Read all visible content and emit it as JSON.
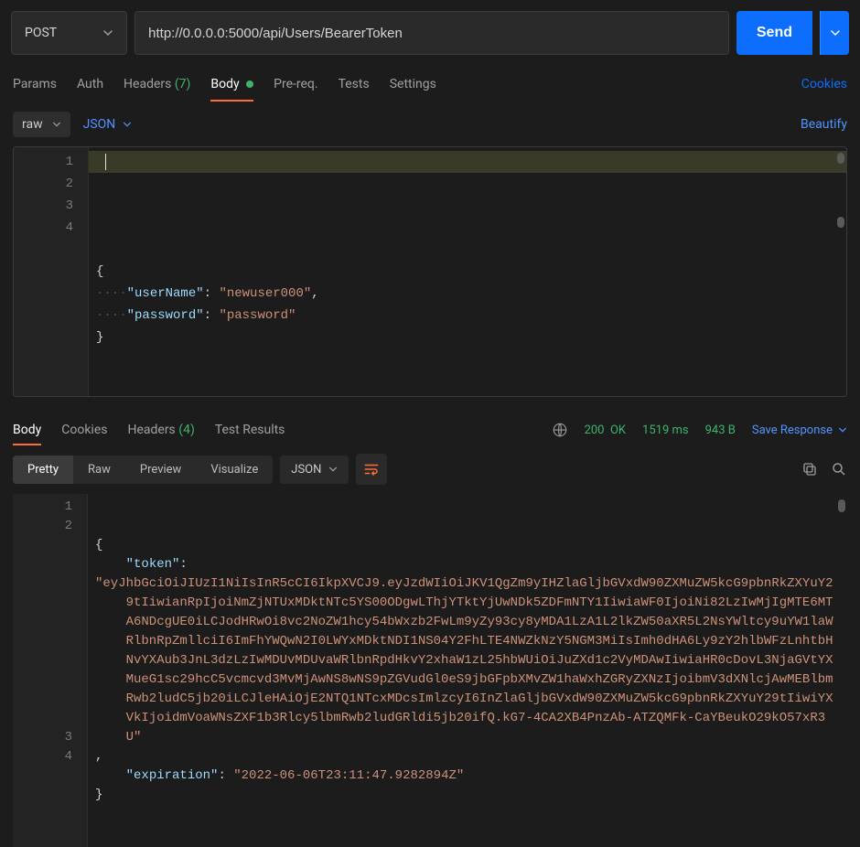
{
  "request": {
    "method": "POST",
    "url": "http://0.0.0.0:5000/api/Users/BearerToken",
    "send_label": "Send"
  },
  "req_tabs": {
    "params": "Params",
    "auth": "Auth",
    "headers_label": "Headers",
    "headers_count": "(7)",
    "body": "Body",
    "prereq": "Pre-req.",
    "tests": "Tests",
    "settings": "Settings",
    "cookies": "Cookies"
  },
  "body_toolbar": {
    "mode": "raw",
    "format": "JSON",
    "beautify": "Beautify"
  },
  "body_editor": {
    "lines": [
      "1",
      "2",
      "3",
      "4"
    ],
    "content": {
      "l1": "{",
      "l2_key": "\"userName\"",
      "l2_val": "\"newuser000\"",
      "l3_key": "\"password\"",
      "l3_val": "\"password\"",
      "l4": "}"
    }
  },
  "resp_tabs": {
    "body": "Body",
    "cookies": "Cookies",
    "headers_label": "Headers",
    "headers_count": "(4)",
    "test_results": "Test Results"
  },
  "status": {
    "code": "200",
    "text": "OK",
    "time": "1519 ms",
    "size": "943 B",
    "save": "Save Response"
  },
  "view_toolbar": {
    "pretty": "Pretty",
    "raw": "Raw",
    "preview": "Preview",
    "visualize": "Visualize",
    "format": "JSON"
  },
  "response_editor": {
    "lines": [
      "1",
      "2",
      "",
      "",
      "",
      "",
      "",
      "",
      "",
      "",
      "",
      "",
      "3",
      "4"
    ],
    "content": {
      "l1": "{",
      "token_key": "\"token\"",
      "token_val": "\"eyJhbGciOiJIUzI1NiIsInR5cCI6IkpXVCJ9.eyJzdWIiOiJKV1QgZm9yIHZlaGljbGVxdW90ZXMuZW5kcG9pbnRkZXYuY29tIiwianRpIjoiNmZjNTUxMDktNTc5YS00ODgwLThjYTktYjUwNDk5ZDFmNTY1IiwiaWF0IjoiNi82LzIwMjIgMTE6MTA6NDcgUE0iLCJodHRwOi8vc2NoZW1hcy54bWxzb2FwLm9yZy93cy8yMDA1LzA1L2lkZW50aXR5L2NsYWltcy9uYW1laWRlbnRpZmllciI6ImFhYWQwN2I0LWYxMDktNDI1NS04Y2FhLTE4NWZkNzY5NGM3MiIsImh0dHA6Ly9zY2hlbWFzLnhtbHNvYXAub3JnL3dzLzIwMDUvMDUvaWRlbnRpdHkvY2xhaW1zL25hbWUiOiJuZXd1c2VyMDAwIiwiaHR0cDovL3NjaGVtYXMueG1sc29hcC5vcmcvd3MvMjAwNS8wNS9pZGVudGl0eS9jbGFpbXMvZW1haWxhZGRyZXNzIjoibmV3dXNlcjAwMEBlbmRwb2ludC5jb20iLCJleHAiOjE2NTQ1NTcxMDcsImlzcyI6InZlaGljbGVxdW90ZXMuZW5kcG9pbnRkZXYuY29tIiwiYXVkIjoidmVoaWNsZXF1b3Rlcy5lbmRwb2ludGRldi5jb20ifQ.kG7-4CA2XB4PnzAb-ATZQMFk-CaYBeukO29kO57xR3U\"",
      "exp_key": "\"expiration\"",
      "exp_val": "\"2022-06-06T23:11:47.9282894Z\"",
      "l4": "}"
    }
  }
}
